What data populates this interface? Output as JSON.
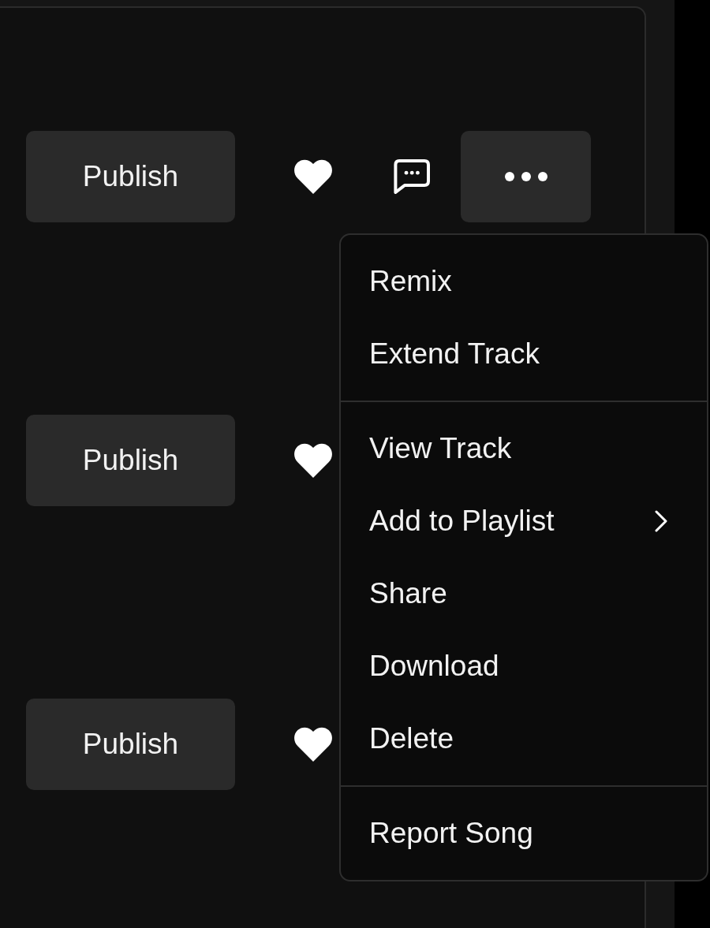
{
  "rows": [
    {
      "publish_label": "Publish",
      "comment": true,
      "more": true
    },
    {
      "publish_label": "Publish",
      "comment": false,
      "more": false
    },
    {
      "publish_label": "Publish",
      "comment": false,
      "more": false
    }
  ],
  "menu": {
    "sections": [
      {
        "items": [
          {
            "label": "Remix",
            "submenu": false
          },
          {
            "label": "Extend Track",
            "submenu": false
          }
        ]
      },
      {
        "items": [
          {
            "label": "View Track",
            "submenu": false
          },
          {
            "label": "Add to Playlist",
            "submenu": true
          },
          {
            "label": "Share",
            "submenu": false
          },
          {
            "label": "Download",
            "submenu": false
          },
          {
            "label": "Delete",
            "submenu": false
          }
        ]
      },
      {
        "items": [
          {
            "label": "Report Song",
            "submenu": false
          }
        ]
      }
    ]
  }
}
